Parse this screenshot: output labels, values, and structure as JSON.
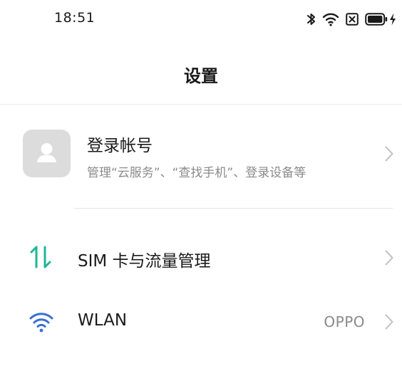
{
  "status_bar": {
    "time": "18:51",
    "icons": [
      "bluetooth-icon",
      "wifi-icon",
      "no-sim-icon",
      "battery-icon",
      "charging-icon"
    ]
  },
  "header": {
    "title": "设置"
  },
  "account": {
    "title": "登录帐号",
    "subtitle": "管理“云服务”、“查找手机”、登录设备等",
    "icon": "person-icon",
    "chevron": "chevron-right-icon"
  },
  "settings": [
    {
      "label": "SIM 卡与流量管理",
      "icon": "data-transfer-icon",
      "icon_color": "#1fb59a",
      "value": ""
    },
    {
      "label": "WLAN",
      "icon": "wifi-icon",
      "icon_color": "#3b6fd4",
      "value": "OPPO"
    }
  ],
  "colors": {
    "chevron": "#c4c4c4",
    "secondary_text": "#8a8a8a",
    "avatar_bg": "#dcdcdc"
  }
}
